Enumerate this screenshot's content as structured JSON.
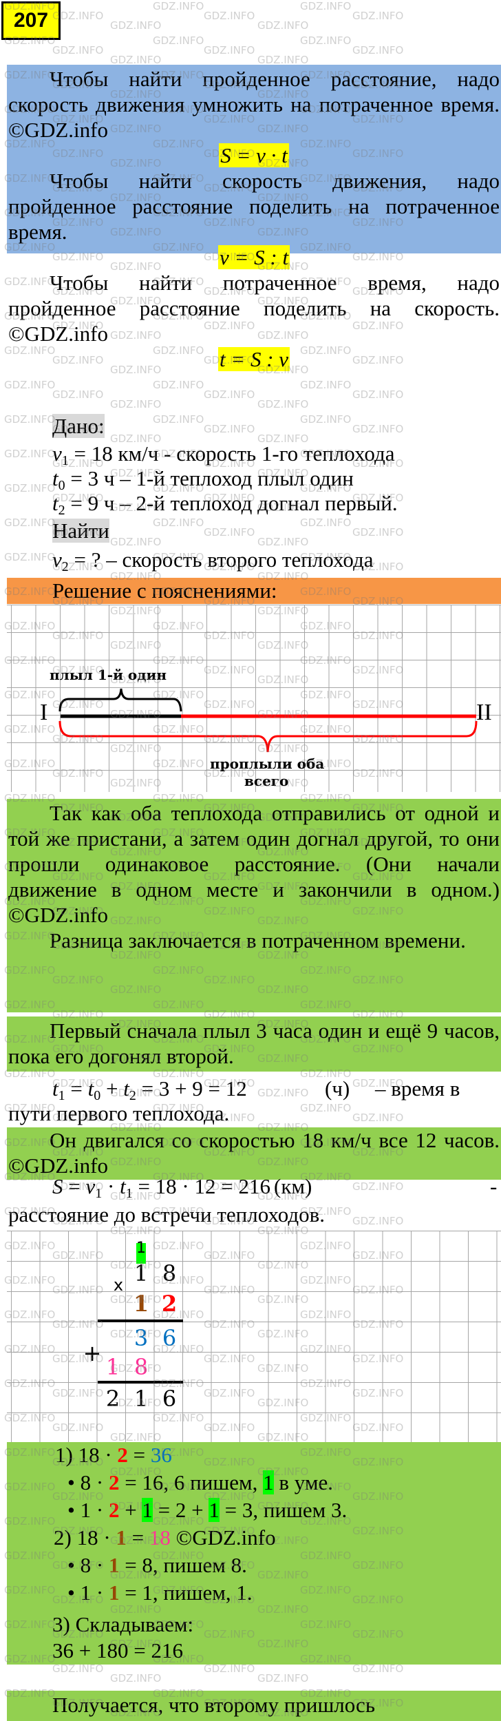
{
  "problem_number": "207",
  "theory": {
    "p1": "Чтобы найти пройденное расстояние, надо скорость движения умножить на потраченное время. ©GDZ.info",
    "f1": "S = v · t",
    "p2": "Чтобы найти скорость движения, надо пройденное расстояние поделить на потраченное время.",
    "f2": "v = S : t",
    "p3": "Чтобы найти потраченное время, надо пройденное расстояние поделить на скорость. ©GDZ.info",
    "f3": "t = S : v"
  },
  "given": {
    "label": "Дано:",
    "v1_var": "v",
    "v1_sub": "1",
    "v1_text": " = 18 км/ч  - скорость 1-го теплохода",
    "t0_var": "t",
    "t0_sub": "0",
    "t0_text": " = 3 ч – 1-й теплоход плыл один",
    "t2_var": "t",
    "t2_sub": "2",
    "t2_text": " = 9 ч – 2-й теплоход догнал первый.",
    "find_label": "Найти",
    "v2_var": "v",
    "v2_sub": "2",
    "v2_text": " = ? – скорость второго теплохода"
  },
  "solution_header": "Решение с пояснениями:",
  "diagram": {
    "label_top": "плыл 1-й один",
    "point_start": "I",
    "point_end": "II",
    "label_bottom_1": "проплыли оба",
    "label_bottom_2": "всего",
    "color_first": "#000000",
    "color_total": "#ff0000"
  },
  "explanation": {
    "p1": "Так как оба теплохода отправились от одной и той же пристани, а затем один догнал другой, то они прошли одинаковое расстояние. (Они начали движение в одном месте и закончили в одном.) ©GDZ.info",
    "p2": "Разница заключается в потраченном времени.",
    "p3": "Первый сначала плыл 3 часа один и ещё 9 часов, пока его догонял второй.",
    "t1_formula_a": "t",
    "t1_formula_b": " = ",
    "t1_formula_rest": "3 + 9 = 12",
    "t1_unit": "(ч)",
    "t1_desc_a": "–  время  в",
    "t1_desc_b": "пути первого теплохода.",
    "p4": "Он двигался со скоростью 18 км/ч все 12 часов.  ©GDZ.info",
    "s_formula_rest": " = 18 · 12 = 216",
    "s_unit": "(км)",
    "s_dash": "-",
    "s_desc": "расстояние до встречи теплоходов."
  },
  "column_multiplication": {
    "carry": "1",
    "multiplicand": [
      "1",
      "8"
    ],
    "op_mult": "x",
    "multiplier": [
      "1",
      "2"
    ],
    "partial1": [
      "3",
      "6"
    ],
    "op_add": "+",
    "partial2": [
      "1",
      "8"
    ],
    "result": [
      "2",
      "1",
      "6"
    ]
  },
  "steps": {
    "s1_a": "1) 18 · ",
    "s1_b": "2",
    "s1_c": " = ",
    "s1_d": "36",
    "s1_1_a": "• 8 · ",
    "s1_1_b": "2",
    "s1_1_c": " = 16, 6 пишем, ",
    "s1_1_d": "1",
    "s1_1_e": " в уме.",
    "s1_2_a": "• 1 · ",
    "s1_2_b": "2",
    "s1_2_c": " + ",
    "s1_2_d": "1",
    "s1_2_e": " = 2 + ",
    "s1_2_f": "1",
    "s1_2_g": " = 3, пишем 3.",
    "s2_a": "2) 18 · ",
    "s2_b": "1",
    "s2_c": " = ",
    "s2_d": "18",
    "s2_e": "   ©GDZ.info",
    "s2_1_a": "• 8 · ",
    "s2_1_b": "1",
    "s2_1_c": " = 8, пишем 8.",
    "s2_2_a": "• 1 · ",
    "s2_2_b": "1",
    "s2_2_c": " = 1, пишем, 1.",
    "s3": "3) Складываем:",
    "s3_sum": "36 + 180 = 216"
  },
  "final": "Получается,   что   второму   пришлось",
  "watermark": "GDZ.INFO"
}
